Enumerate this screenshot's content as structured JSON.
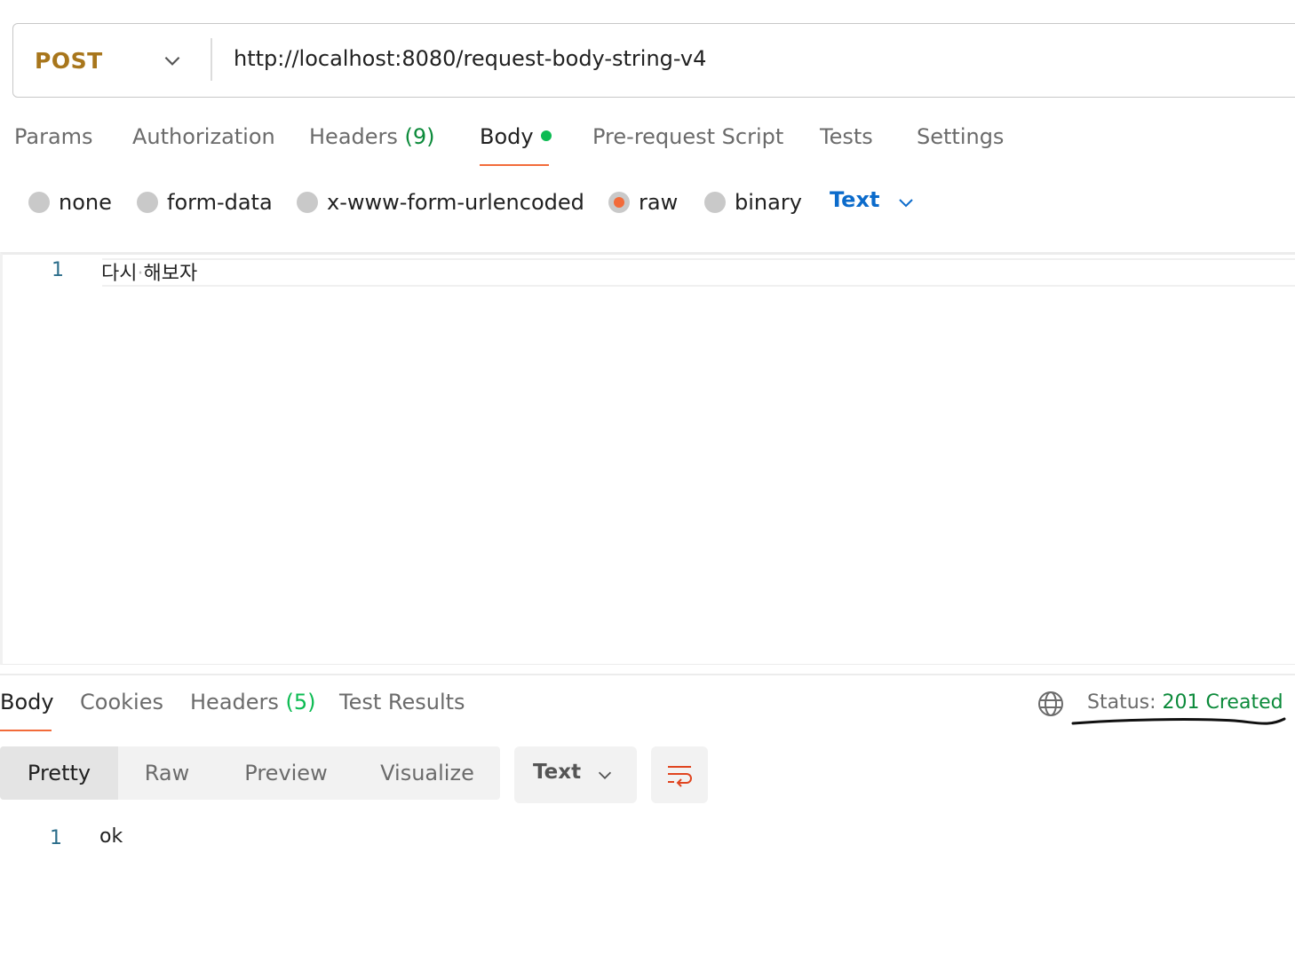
{
  "request": {
    "method": "POST",
    "url": "http://localhost:8080/request-body-string-v4"
  },
  "request_tabs": [
    {
      "label": "Params"
    },
    {
      "label": "Authorization"
    },
    {
      "label": "Headers",
      "count": "(9)"
    },
    {
      "label": "Body",
      "active": true
    },
    {
      "label": "Pre-request Script"
    },
    {
      "label": "Tests"
    },
    {
      "label": "Settings"
    }
  ],
  "body_types": [
    {
      "label": "none"
    },
    {
      "label": "form-data"
    },
    {
      "label": "x-www-form-urlencoded"
    },
    {
      "label": "raw",
      "selected": true
    },
    {
      "label": "binary"
    }
  ],
  "body_format": "Text",
  "editor": {
    "line_number": "1",
    "word1": "다시",
    "word2": "해보자"
  },
  "response_tabs": [
    {
      "label": "Body",
      "active": true
    },
    {
      "label": "Cookies"
    },
    {
      "label": "Headers",
      "count": "(5)"
    },
    {
      "label": "Test Results"
    }
  ],
  "status": {
    "label": "Status:",
    "value": "201 Created"
  },
  "view_modes": [
    {
      "label": "Pretty",
      "active": true
    },
    {
      "label": "Raw"
    },
    {
      "label": "Preview"
    },
    {
      "label": "Visualize"
    }
  ],
  "response_format": "Text",
  "response_body": {
    "line_number": "1",
    "content": "ok"
  },
  "colors": {
    "method": "#a8761c",
    "accent": "#f26b3a",
    "success": "#0b8a3a",
    "link": "#0b6bcb"
  },
  "icons": [
    "chevron-down-icon",
    "globe-icon",
    "wrap-lines-icon"
  ]
}
